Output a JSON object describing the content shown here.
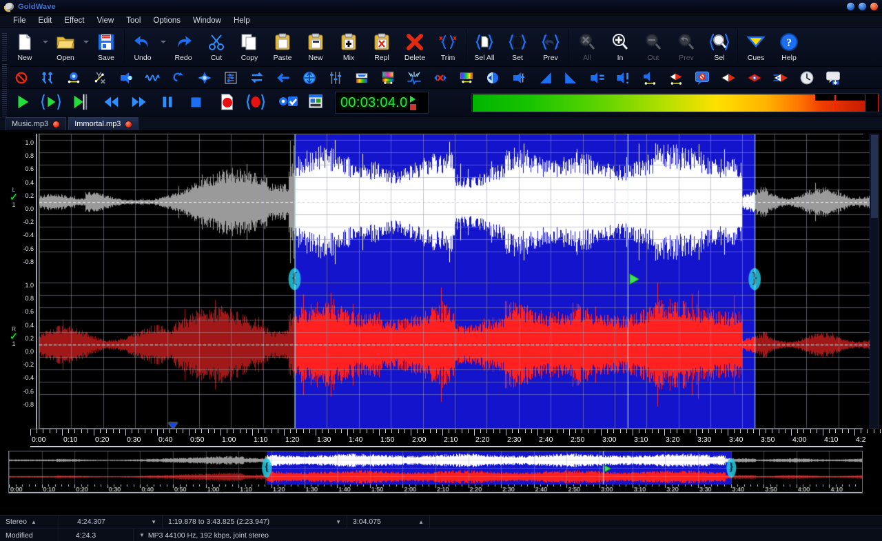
{
  "window": {
    "title": "GoldWave",
    "app_icon": "goldwave-disc-icon",
    "buttons": {
      "minimize": "minimize",
      "maximize": "maximize",
      "close": "close"
    }
  },
  "menubar": {
    "items": [
      "File",
      "Edit",
      "Effect",
      "View",
      "Tool",
      "Options",
      "Window",
      "Help"
    ]
  },
  "toolbar_main": {
    "groups": [
      {
        "buttons": [
          {
            "label": "New",
            "icon": "new-file-icon",
            "enabled": true,
            "dropdown": true
          },
          {
            "label": "Open",
            "icon": "open-folder-icon",
            "enabled": true,
            "dropdown": true
          },
          {
            "label": "Save",
            "icon": "floppy-save-icon",
            "enabled": true,
            "dropdown": false
          }
        ]
      },
      {
        "buttons": [
          {
            "label": "Undo",
            "icon": "undo-arrow-icon",
            "enabled": true,
            "dropdown": true
          },
          {
            "label": "Redo",
            "icon": "redo-arrow-icon",
            "enabled": true,
            "dropdown": false
          },
          {
            "label": "Cut",
            "icon": "scissors-icon",
            "enabled": true,
            "dropdown": false
          },
          {
            "label": "Copy",
            "icon": "copy-pages-icon",
            "enabled": true,
            "dropdown": false
          },
          {
            "label": "Paste",
            "icon": "clipboard-paste-icon",
            "enabled": true,
            "dropdown": false
          },
          {
            "label": "New",
            "icon": "clipboard-new-icon",
            "enabled": true,
            "dropdown": false
          },
          {
            "label": "Mix",
            "icon": "clipboard-mix-icon",
            "enabled": true,
            "dropdown": false
          },
          {
            "label": "Repl",
            "icon": "clipboard-replace-icon",
            "enabled": true,
            "dropdown": false
          },
          {
            "label": "Delete",
            "icon": "red-x-delete-icon",
            "enabled": true,
            "dropdown": false
          },
          {
            "label": "Trim",
            "icon": "trim-braces-icon",
            "enabled": true,
            "dropdown": false
          }
        ]
      },
      {
        "buttons": [
          {
            "label": "Sel All",
            "icon": "select-all-icon",
            "enabled": true,
            "dropdown": false
          },
          {
            "label": "Set",
            "icon": "set-selection-icon",
            "enabled": true,
            "dropdown": false
          },
          {
            "label": "Prev",
            "icon": "previous-selection-icon",
            "enabled": true,
            "dropdown": false
          }
        ]
      },
      {
        "buttons": [
          {
            "label": "All",
            "icon": "zoom-all-icon",
            "enabled": false,
            "dropdown": false
          },
          {
            "label": "In",
            "icon": "zoom-in-icon",
            "enabled": true,
            "dropdown": false
          },
          {
            "label": "Out",
            "icon": "zoom-out-icon",
            "enabled": false,
            "dropdown": false
          },
          {
            "label": "Prev",
            "icon": "zoom-previous-icon",
            "enabled": false,
            "dropdown": false
          },
          {
            "label": "Sel",
            "icon": "zoom-selection-icon",
            "enabled": true,
            "dropdown": false
          }
        ]
      },
      {
        "buttons": [
          {
            "label": "Cues",
            "icon": "cue-marker-icon",
            "enabled": true,
            "dropdown": false
          },
          {
            "label": "Help",
            "icon": "help-question-icon",
            "enabled": true,
            "dropdown": false
          }
        ]
      }
    ]
  },
  "toolbar_effects": {
    "buttons": [
      "no-effect-icon",
      "volume-shape-icon",
      "auto-gain-icon",
      "envelope-shape-icon",
      "change-volume-icon",
      "compressor-icon",
      "dynamics-icon",
      "doppler-icon",
      "equalizer-icon",
      "exchange-channels-icon",
      "offset-left-icon",
      "offset-updown-icon",
      "filter-sliders-icon",
      "bandpass-icon",
      "noise-reduction-icon",
      "spike-reduction-icon",
      "pop-click-icon",
      "spectrum-filter-icon",
      "invert-icon",
      "mechanize-icon",
      "fade-in-icon",
      "fade-out-icon",
      "match-volume-icon",
      "maximize-volume-icon",
      "pan-icon",
      "flanger-icon",
      "echo-balloon-icon",
      "reverb-icon",
      "chorus-icon",
      "stereo-widen-icon",
      "time-warp-icon",
      "resample-balloon-icon"
    ]
  },
  "transport": {
    "buttons": [
      {
        "icon": "play-all-icon",
        "name": "play-all"
      },
      {
        "icon": "play-selection-icon",
        "name": "play-selection"
      },
      {
        "icon": "play-marker-icon",
        "name": "play-from-marker"
      },
      {
        "icon": "rewind-icon",
        "name": "rewind"
      },
      {
        "icon": "fast-forward-icon",
        "name": "fast-forward"
      },
      {
        "icon": "pause-icon",
        "name": "pause"
      },
      {
        "icon": "stop-icon",
        "name": "stop"
      },
      {
        "icon": "record-new-icon",
        "name": "record-new-file"
      },
      {
        "icon": "record-selection-icon",
        "name": "record-into-selection"
      },
      {
        "icon": "record-settings-icon",
        "name": "record-settings"
      },
      {
        "icon": "control-properties-icon",
        "name": "control-properties"
      }
    ],
    "time_display": "00:03:04.0",
    "mini_icons": [
      "play-indicator",
      "stop-indicator"
    ],
    "level_meter": "stereo-level-meter"
  },
  "tabs": [
    {
      "label": "Music.mp3",
      "active": false,
      "icon": "record-dot-icon"
    },
    {
      "label": "Immortal.mp3",
      "active": true,
      "icon": "record-dot-icon"
    }
  ],
  "waveform": {
    "channels": [
      {
        "letter": "L",
        "number": "1",
        "enabled": true,
        "color": "#ffffff"
      },
      {
        "letter": "R",
        "number": "1",
        "enabled": true,
        "color": "#ff2020"
      }
    ],
    "y_ticks": [
      "1.0",
      "0.8",
      "0.6",
      "0.4",
      "0.2",
      "0.0",
      "-0.2",
      "-0.4",
      "-0.6",
      "-0.8"
    ],
    "time_ticks": [
      "0:00",
      "0:10",
      "0:20",
      "0:30",
      "0:40",
      "0:50",
      "1:00",
      "1:10",
      "1:20",
      "1:30",
      "1:40",
      "1:50",
      "2:00",
      "2:10",
      "2:20",
      "2:30",
      "2:40",
      "2:50",
      "3:00",
      "3:10",
      "3:20",
      "3:30",
      "3:40",
      "3:50",
      "4:00",
      "4:10",
      "4:2"
    ],
    "selection": {
      "start": "1:19.878",
      "end": "3:43.825",
      "length": "2:23.947"
    },
    "playback_marker": "3:04.075",
    "cue_marker_time": "0:45",
    "colors": {
      "selection_fill": "#1414cc",
      "selection_handle": "#1fd6e8",
      "left_channel": "#ffffff",
      "right_channel": "#ff2020",
      "unselected_left": "#9a9a9a",
      "unselected_right": "#a01818",
      "grid": "#6e7380",
      "background": "#000000",
      "playhead": "#3ce05a"
    }
  },
  "statusbar": {
    "row1": {
      "channels": "Stereo",
      "total_time": "4:24.307",
      "selection_info": "1:19.878 to 3:43.825 (2:23.947)",
      "position": "3:04.075"
    },
    "row2": {
      "state": "Modified",
      "duration": "4:24.3",
      "format": "MP3 44100 Hz, 192 kbps, joint stereo"
    }
  }
}
